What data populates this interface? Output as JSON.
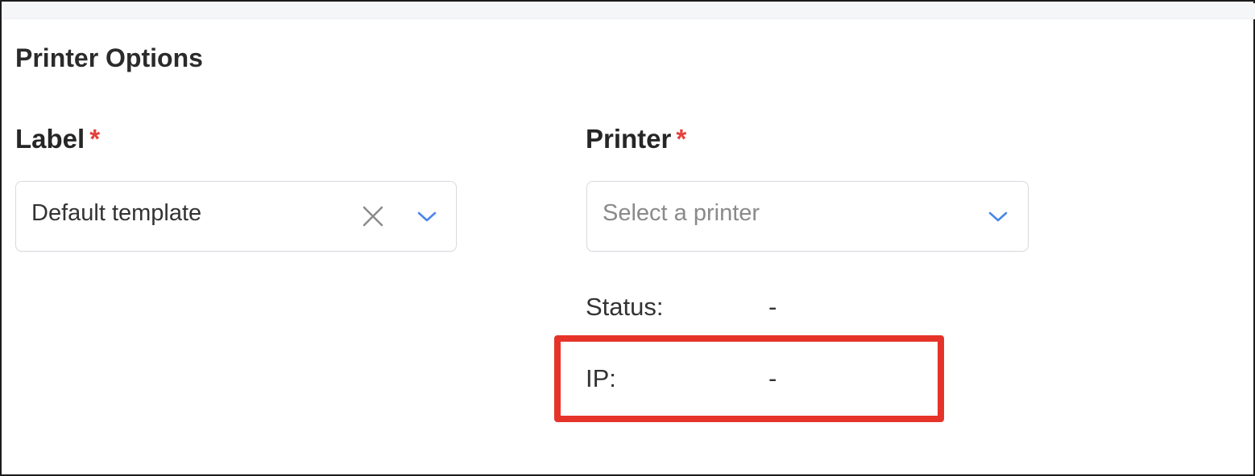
{
  "section": {
    "title": "Printer Options"
  },
  "label_field": {
    "label": "Label",
    "required_mark": "*",
    "value": "Default template",
    "clear_icon": "close-icon",
    "dropdown_icon": "chevron-down-icon"
  },
  "printer_field": {
    "label": "Printer",
    "required_mark": "*",
    "placeholder": "Select a printer",
    "dropdown_icon": "chevron-down-icon"
  },
  "printer_info": {
    "status_label": "Status:",
    "status_value": "-",
    "ip_label": "IP:",
    "ip_value": "-"
  },
  "colors": {
    "required": "#e5403a",
    "chevron": "#4a86e8",
    "highlight": "#e63329",
    "border": "#d7dae0"
  }
}
